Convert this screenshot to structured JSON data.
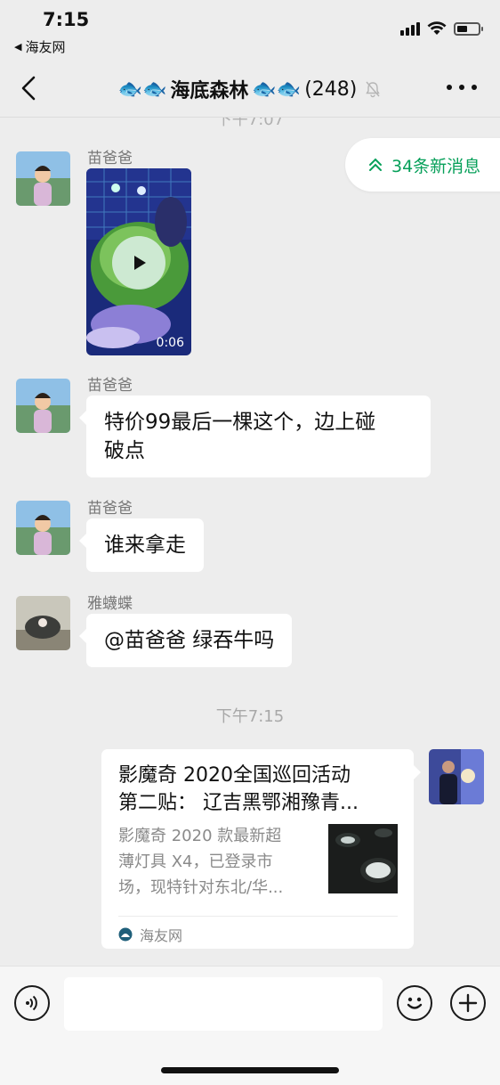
{
  "status_bar": {
    "time": "7:15",
    "back_app": "海友网"
  },
  "header": {
    "title_fish_prefix": "🐟🐟",
    "title_name": "海底森林",
    "title_fish_suffix": "🐟🐟",
    "member_count": "(248)"
  },
  "chat": {
    "cut_timestamp": "下午7:07",
    "new_messages_label": "34条新消息",
    "messages": [
      {
        "sender": "苗爸爸",
        "type": "video",
        "duration": "0:06"
      },
      {
        "sender": "苗爸爸",
        "type": "text",
        "lines": [
          "特价99最后一棵这个，边上碰",
          "破点"
        ]
      },
      {
        "sender": "苗爸爸",
        "type": "text",
        "text": "谁来拿走"
      },
      {
        "sender": "雅蠛蝶",
        "type": "text",
        "text": "@苗爸爸 绿吞牛吗"
      }
    ],
    "timestamp": "下午7:15",
    "link_card": {
      "title_lines": [
        "影魔奇 2020全国巡回活动",
        "第二贴： 辽吉黑鄂湘豫青..."
      ],
      "description_lines": [
        "影魔奇 2020 款最新超",
        "薄灯具 X4，已登录市",
        "场，现特针对东北/华..."
      ],
      "source": "海友网"
    }
  },
  "input_bar": {
    "placeholder": ""
  },
  "colors": {
    "background": "#ededed",
    "accent_green": "#07a05a",
    "bubble": "#ffffff"
  },
  "icons": [
    "back-chevron-icon",
    "mute-bell-icon",
    "more-dots-icon",
    "double-chevron-up-icon",
    "play-icon",
    "voice-icon",
    "emoji-icon",
    "plus-icon",
    "source-logo-icon"
  ]
}
